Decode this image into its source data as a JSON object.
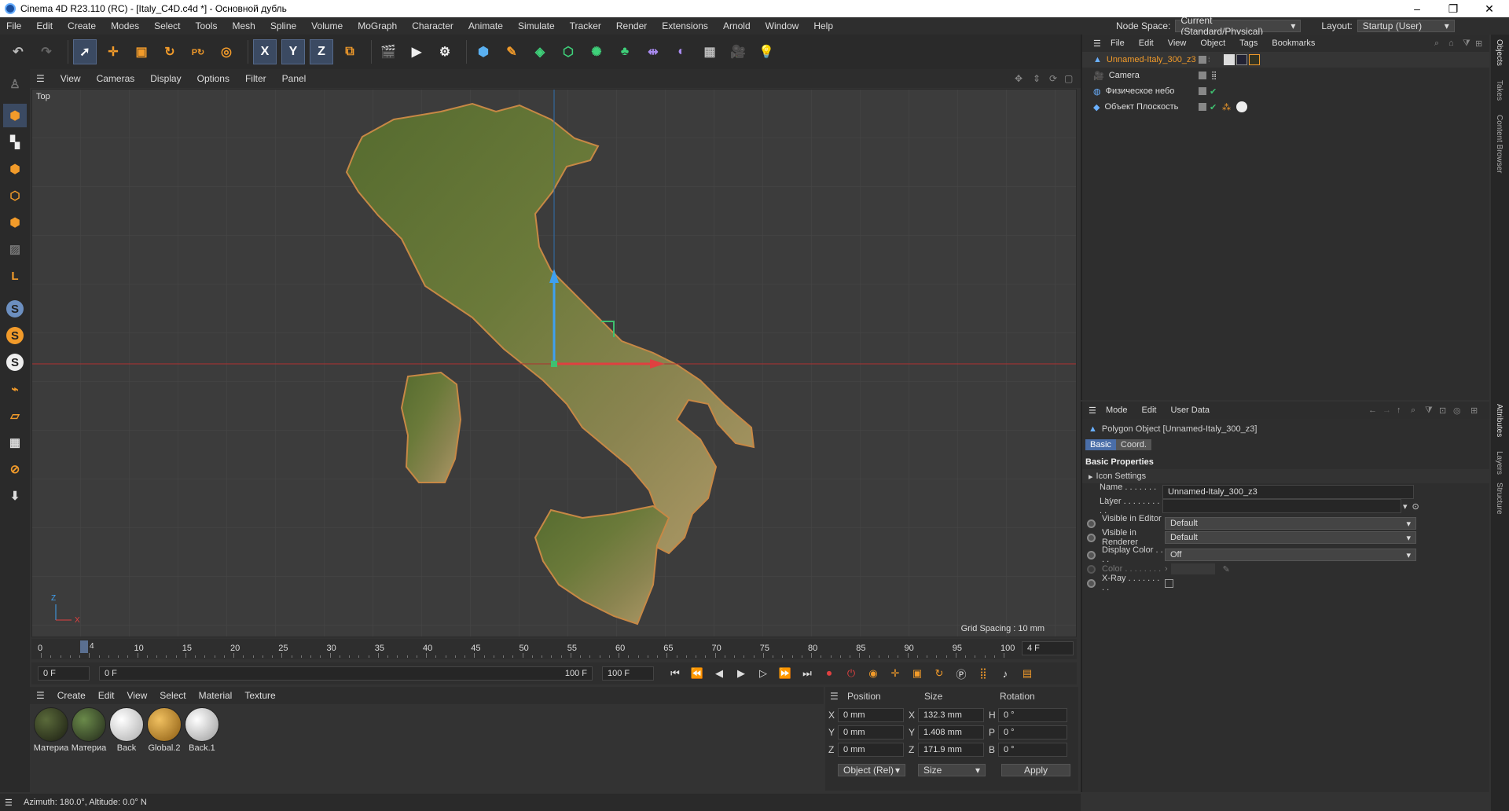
{
  "window": {
    "title": "Cinema 4D R23.110 (RC) - [Italy_C4D.c4d *] - Основной дубль",
    "minimize": "–",
    "maximize": "❐",
    "close": "✕"
  },
  "menu": {
    "items": [
      "File",
      "Edit",
      "Create",
      "Modes",
      "Select",
      "Tools",
      "Mesh",
      "Spline",
      "Volume",
      "MoGraph",
      "Character",
      "Animate",
      "Simulate",
      "Tracker",
      "Render",
      "Extensions",
      "Arnold",
      "Window",
      "Help"
    ],
    "node_space_label": "Node Space:",
    "node_space_value": "Current (Standard/Physical)",
    "layout_label": "Layout:",
    "layout_value": "Startup (User)"
  },
  "toolbar": {
    "x_label": "X",
    "y_label": "Y",
    "z_label": "Z"
  },
  "lefttools": {
    "s1": "S",
    "s2": "S",
    "s3": "S",
    "l": "L"
  },
  "viewport": {
    "menu": [
      "View",
      "Cameras",
      "Display",
      "Options",
      "Filter",
      "Panel"
    ],
    "label": "Top",
    "grid_spacing": "Grid Spacing : 10 mm",
    "axis_z": "Z",
    "axis_x": "X"
  },
  "timeline": {
    "ticks": [
      "0",
      "10",
      "15",
      "20",
      "25",
      "30",
      "35",
      "40",
      "45",
      "50",
      "55",
      "60",
      "65",
      "70",
      "75",
      "80",
      "85",
      "90",
      "95",
      "100"
    ],
    "current_marker": "4",
    "frame_field": "4 F"
  },
  "playbar": {
    "start": "0 F",
    "range_start": "0 F",
    "range_end": "100 F",
    "end": "100 F"
  },
  "materials": {
    "menu": [
      "Create",
      "Edit",
      "View",
      "Select",
      "Material",
      "Texture"
    ],
    "items": [
      {
        "name": "Материа",
        "color": "#1b1d12"
      },
      {
        "name": "Материа",
        "color": "#22281a"
      },
      {
        "name": "Back",
        "color": "#e8e8e8"
      },
      {
        "name": "Global.2",
        "color": "#c8871a"
      },
      {
        "name": "Back.1",
        "color": "#d8d8d8"
      }
    ]
  },
  "coords": {
    "headers": {
      "position": "Position",
      "size": "Size",
      "rotation": "Rotation"
    },
    "rows": [
      {
        "axis": "X",
        "pos": "0 mm",
        "size_axis": "X",
        "size": "132.3 mm",
        "rot_axis": "H",
        "rot": "0 °"
      },
      {
        "axis": "Y",
        "pos": "0 mm",
        "size_axis": "Y",
        "size": "1.408 mm",
        "rot_axis": "P",
        "rot": "0 °"
      },
      {
        "axis": "Z",
        "pos": "0 mm",
        "size_axis": "Z",
        "size": "171.9 mm",
        "rot_axis": "B",
        "rot": "0 °"
      }
    ],
    "mode": "Object (Rel)",
    "size_mode": "Size",
    "apply": "Apply"
  },
  "status": {
    "text": "Azimuth: 180.0°, Altitude: 0.0°  N"
  },
  "objects": {
    "menu": [
      "File",
      "Edit",
      "View",
      "Object",
      "Tags",
      "Bookmarks"
    ],
    "items": [
      {
        "name": "Unnamed-Italy_300_z3",
        "selected": true
      },
      {
        "name": "Camera"
      },
      {
        "name": "Физическое небо"
      },
      {
        "name": "Объект Плоскость"
      }
    ]
  },
  "attributes": {
    "menu": [
      "Mode",
      "Edit",
      "User Data"
    ],
    "object_title": "Polygon Object [Unnamed-Italy_300_z3]",
    "tabs": [
      "Basic",
      "Coord."
    ],
    "section": "Basic Properties",
    "icon_settings": "Icon Settings",
    "fields": {
      "name_label": "Name . . . . . . . . . .",
      "name_value": "Unnamed-Italy_300_z3",
      "layer_label": "Layer . . . . . . . . . .",
      "vis_editor_label": "Visible in Editor . .",
      "vis_editor_value": "Default",
      "vis_render_label": "Visible in Renderer",
      "vis_render_value": "Default",
      "display_color_label": "Display Color . . . .",
      "display_color_value": "Off",
      "color_label": "Color . . . . . . . .",
      "xray_label": "X-Ray . . . . . . . . ."
    }
  },
  "side_tabs": {
    "objects": "Objects",
    "takes": "Takes",
    "content_browser": "Content Browser",
    "attributes": "Attributes",
    "layers": "Layers",
    "structure": "Structure"
  }
}
